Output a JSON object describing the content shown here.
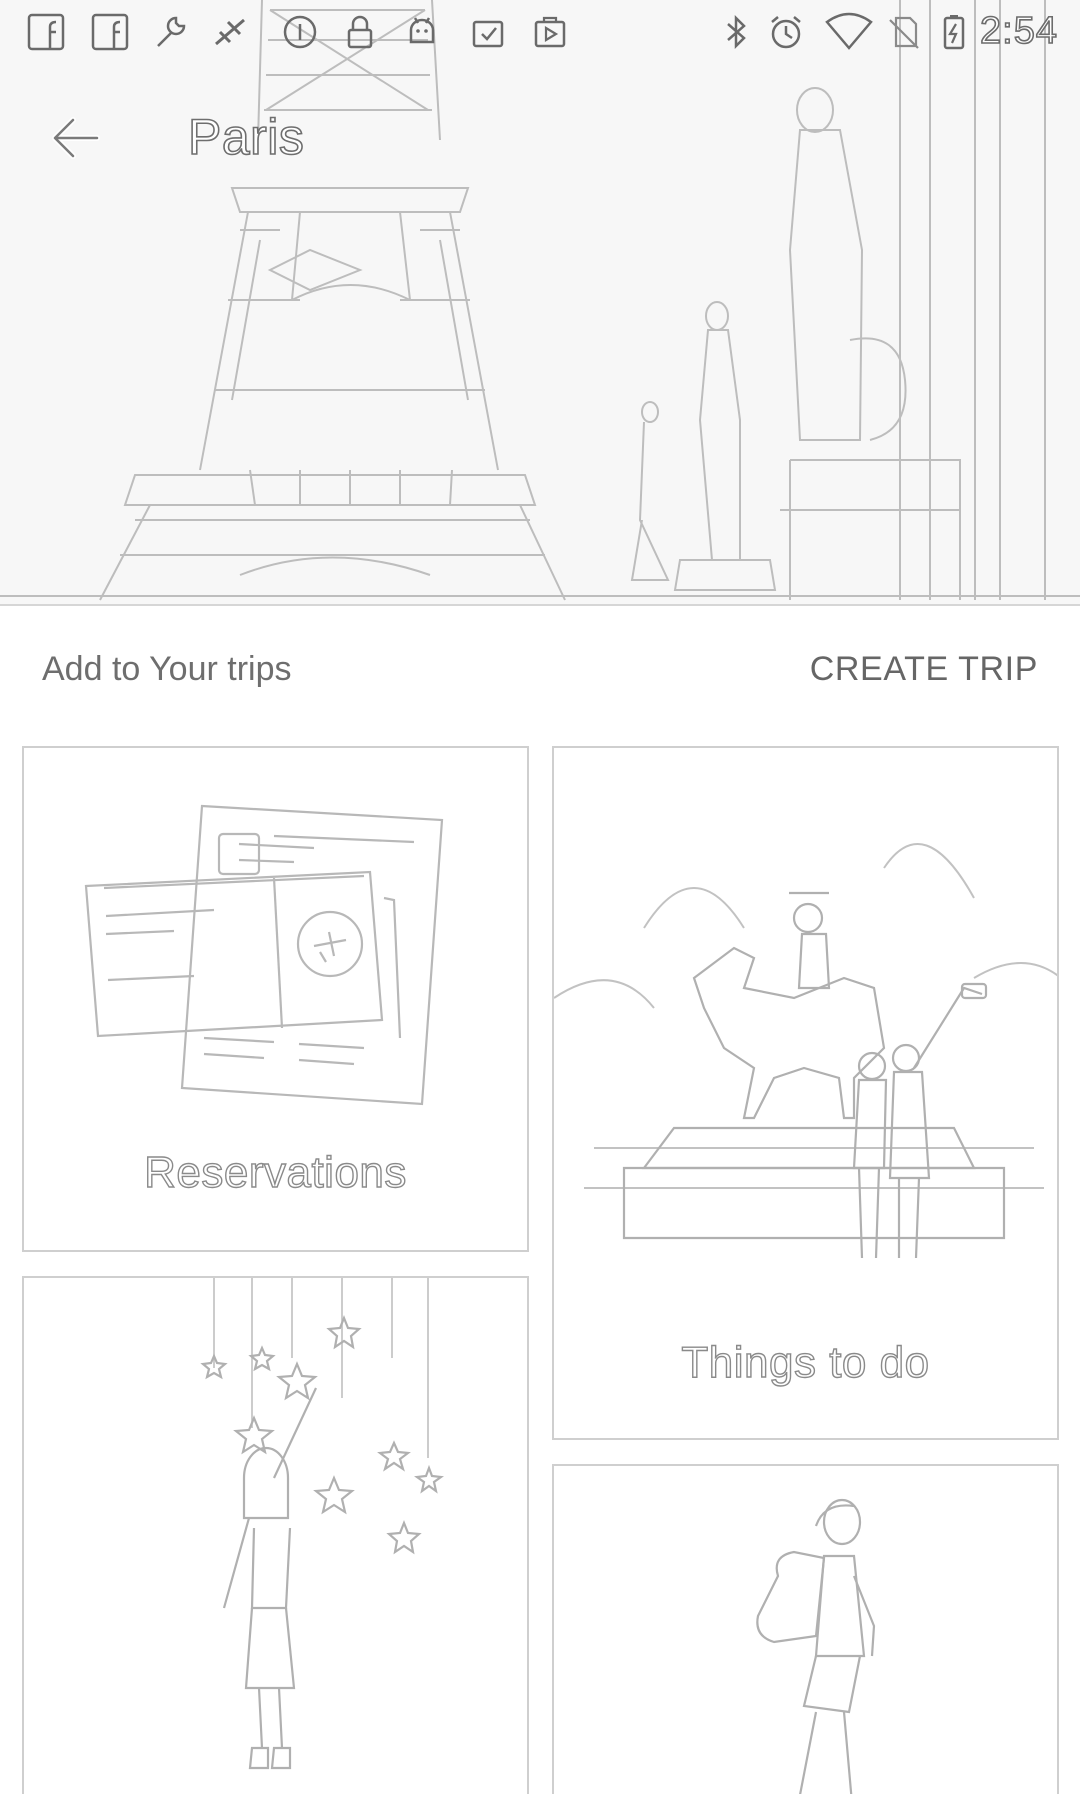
{
  "status_bar": {
    "time": "2:54",
    "icons": [
      "facebook-icon",
      "facebook-icon",
      "wrench-icon",
      "fitness-icon",
      "data-saver-icon",
      "lock-icon",
      "android-icon",
      "clipboard-check-icon",
      "play-store-icon",
      "bluetooth-icon",
      "alarm-icon",
      "wifi-icon",
      "no-sim-icon",
      "battery-charging-icon"
    ]
  },
  "header": {
    "back_icon": "arrow-back-icon",
    "title": "Paris"
  },
  "trips": {
    "add_label": "Add to Your trips",
    "create_label": "CREATE TRIP"
  },
  "cards": {
    "reservations": {
      "label": "Reservations",
      "icon": "plane-ticket-illustration"
    },
    "things_to_do": {
      "label": "Things to do",
      "icon": "statue-selfie-illustration"
    },
    "wishlist": {
      "label": "",
      "icon": "reaching-stars-illustration"
    },
    "explore": {
      "label": "",
      "icon": "hiker-illustration"
    }
  },
  "colors": {
    "background": "#ffffff",
    "line": "#bdbdbd",
    "text": "#6e6e6e"
  }
}
